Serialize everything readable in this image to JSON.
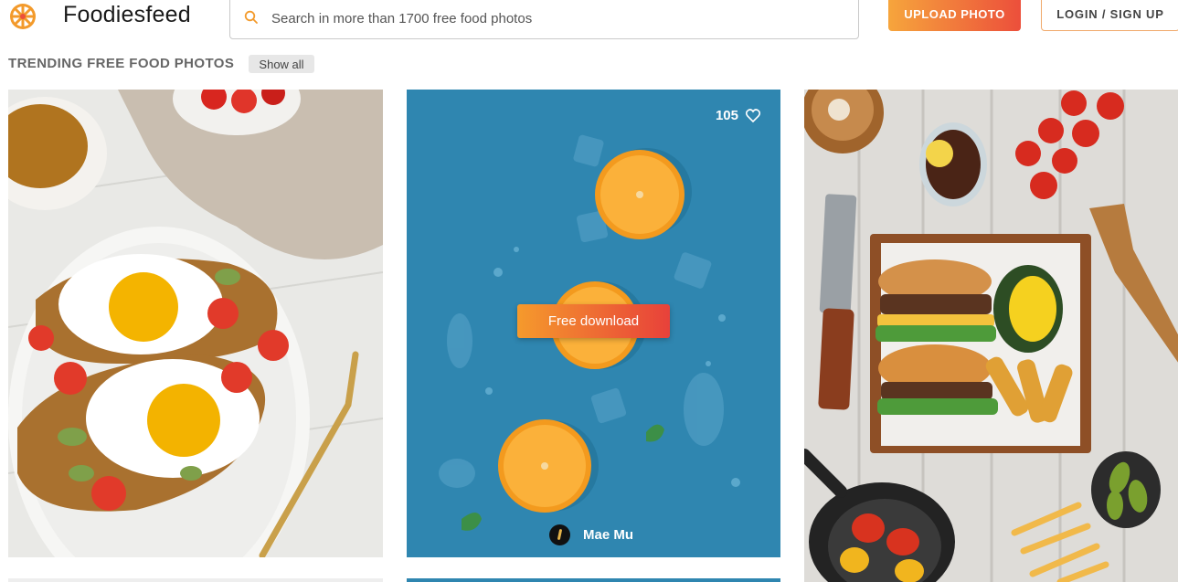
{
  "header": {
    "brand": "Foodiesfeed",
    "logo_icon": "orange-slice-logo-icon",
    "search": {
      "placeholder": "Search in more than 1700 free food photos",
      "value": ""
    },
    "upload_label": "UPLOAD PHOTO",
    "login_label": "LOGIN / SIGN UP"
  },
  "section": {
    "title": "TRENDING FREE FOOD PHOTOS",
    "show_all_label": "Show all"
  },
  "cards": [
    {
      "subject": "eggs-avocado-toast-photo"
    },
    {
      "subject": "oranges-on-blue-photo",
      "likes": "105",
      "download_label": "Free download",
      "author": "Mae Mu"
    },
    {
      "subject": "burgers-fries-board-photo"
    }
  ],
  "colors": {
    "accent_start": "#f6a53c",
    "accent_end": "#ec4f3b",
    "blue_bg": "#2f86b0"
  }
}
